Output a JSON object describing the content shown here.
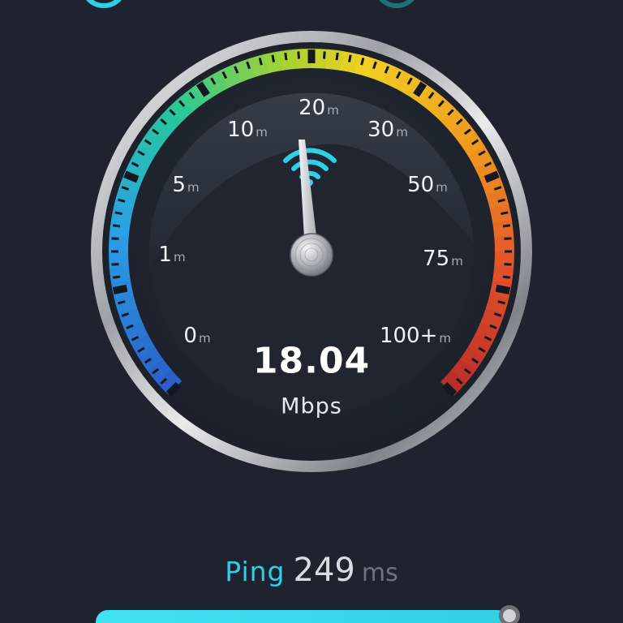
{
  "gauge": {
    "scale_labels": [
      {
        "value": "0",
        "unit": "m"
      },
      {
        "value": "1",
        "unit": "m"
      },
      {
        "value": "5",
        "unit": "m"
      },
      {
        "value": "10",
        "unit": "m"
      },
      {
        "value": "20",
        "unit": "m"
      },
      {
        "value": "30",
        "unit": "m"
      },
      {
        "value": "50",
        "unit": "m"
      },
      {
        "value": "75",
        "unit": "m"
      },
      {
        "value": "100+",
        "unit": "m"
      }
    ],
    "needle_icon": "wifi-icon",
    "speed_value": "18.04",
    "speed_unit": "Mbps",
    "colors": {
      "accent": "#2fd0e6",
      "scale_start": "#2a7de1",
      "scale_mid": "#f0d020",
      "scale_end": "#d83a2a"
    }
  },
  "ping": {
    "label": "Ping",
    "value": "249",
    "unit": "ms"
  },
  "progress": {
    "fraction": 0.98
  }
}
